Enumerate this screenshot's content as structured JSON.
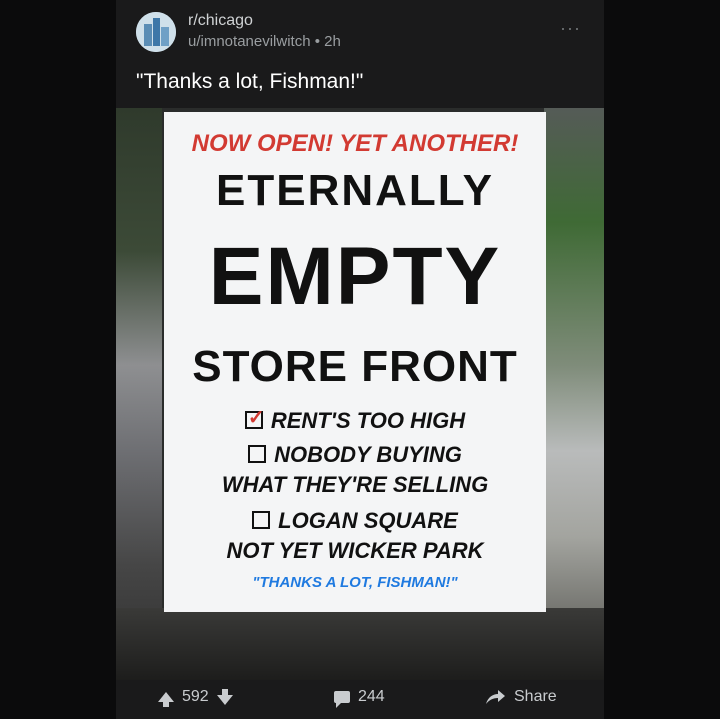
{
  "post": {
    "subreddit": "r/chicago",
    "user": "u/imnotanevilwitch",
    "separator": "•",
    "time": "2h",
    "more_label": "···",
    "title": "\"Thanks a lot, Fishman!\""
  },
  "poster": {
    "line_red": "NOW OPEN! YET ANOTHER!",
    "line2": "ETERNALLY",
    "line3": "EMPTY",
    "line4": "STORE FRONT",
    "check1": "RENT'S TOO HIGH",
    "check2a": "NOBODY BUYING",
    "check2b": "WHAT THEY'RE SELLING",
    "check3a": "LOGAN SQUARE",
    "check3b": "NOT YET WICKER PARK",
    "blue": "\"THANKS A LOT, FISHMAN!\""
  },
  "footer": {
    "upvotes": "592",
    "comments": "244",
    "share_label": "Share"
  },
  "icons": {
    "avatar": "subreddit-avatar-icon",
    "more": "more-options-icon",
    "upvote": "upvote-arrow-icon",
    "downvote": "downvote-arrow-icon",
    "comment": "comment-bubble-icon",
    "share": "share-arrow-icon"
  }
}
